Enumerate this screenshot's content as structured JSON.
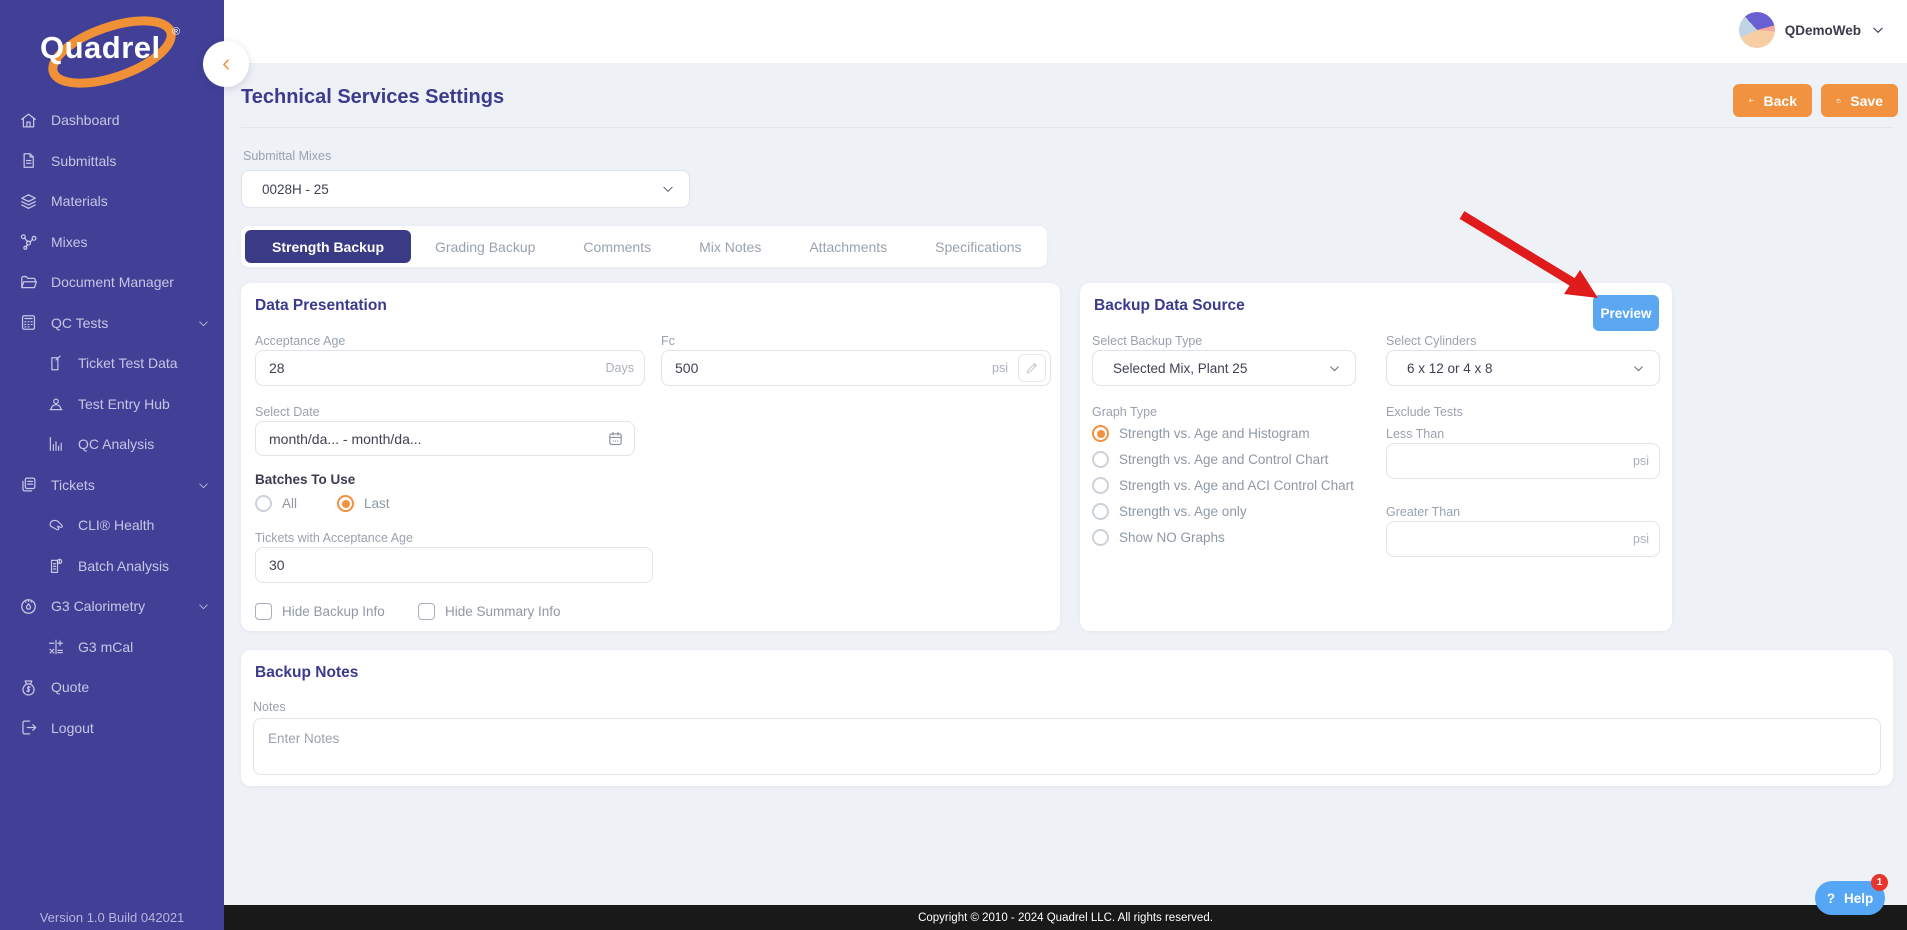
{
  "brand": {
    "name": "Quadrel",
    "registered": "®",
    "version": "Version 1.0 Build 042021"
  },
  "header": {
    "user_name": "QDemoWeb"
  },
  "sidebar": {
    "items": [
      {
        "label": "Dashboard"
      },
      {
        "label": "Submittals"
      },
      {
        "label": "Materials"
      },
      {
        "label": "Mixes"
      },
      {
        "label": "Document Manager"
      },
      {
        "label": "QC Tests"
      },
      {
        "label": "Ticket Test Data"
      },
      {
        "label": "Test Entry Hub"
      },
      {
        "label": "QC Analysis"
      },
      {
        "label": "Tickets"
      },
      {
        "label": "CLI® Health"
      },
      {
        "label": "Batch Analysis"
      },
      {
        "label": "G3 Calorimetry"
      },
      {
        "label": "G3 mCal"
      },
      {
        "label": "Quote"
      },
      {
        "label": "Logout"
      }
    ]
  },
  "page": {
    "title": "Technical Services Settings",
    "back_label": "Back",
    "save_label": "Save"
  },
  "submittal_mixes": {
    "label": "Submittal Mixes",
    "value": "0028H - 25"
  },
  "tabs": [
    {
      "label": "Strength Backup"
    },
    {
      "label": "Grading Backup"
    },
    {
      "label": "Comments"
    },
    {
      "label": "Mix Notes"
    },
    {
      "label": "Attachments"
    },
    {
      "label": "Specifications"
    }
  ],
  "data_presentation": {
    "title": "Data Presentation",
    "acceptance_age": {
      "label": "Acceptance Age",
      "value": "28",
      "unit": "Days"
    },
    "fc": {
      "label": "Fc",
      "value": "500",
      "unit": "psi"
    },
    "select_date": {
      "label": "Select Date",
      "value": "month/da... - month/da..."
    },
    "batches_to_use": {
      "label": "Batches To Use",
      "option_all": "All",
      "option_last": "Last",
      "selected": "Last"
    },
    "tickets_with_acceptance_age": {
      "label": "Tickets with Acceptance Age",
      "value": "30"
    },
    "hide_backup_info": {
      "label": "Hide Backup Info",
      "checked": false
    },
    "hide_summary_info": {
      "label": "Hide Summary Info",
      "checked": false
    }
  },
  "backup_data_source": {
    "title": "Backup Data Source",
    "preview_label": "Preview",
    "select_backup_type": {
      "label": "Select Backup Type",
      "value": "Selected Mix, Plant 25"
    },
    "select_cylinders": {
      "label": "Select Cylinders",
      "value": "6 x 12 or 4 x 8"
    },
    "graph_type": {
      "label": "Graph Type",
      "selected": "Strength vs. Age and Histogram",
      "options": [
        "Strength vs. Age and Histogram",
        "Strength vs. Age and Control Chart",
        "Strength vs. Age and ACI Control Chart",
        "Strength vs. Age only",
        "Show NO Graphs"
      ]
    },
    "exclude_tests": {
      "label": "Exclude Tests",
      "less_than": {
        "label": "Less Than",
        "value": "",
        "unit": "psi"
      },
      "greater_than": {
        "label": "Greater Than",
        "value": "",
        "unit": "psi"
      }
    }
  },
  "backup_notes": {
    "title": "Backup Notes",
    "notes_label": "Notes",
    "placeholder": "Enter Notes"
  },
  "footer": {
    "copyright": "Copyright © 2010 - 2024 Quadrel LLC. All rights reserved."
  },
  "help": {
    "icon": "?",
    "label": "Help",
    "badge": "1"
  },
  "colors": {
    "sidebar": "#413F96",
    "accent_orange": "#F09140",
    "active_tab": "#3B3A85",
    "preview_blue": "#5BA7F2",
    "arrow_red": "#E01B1B"
  }
}
